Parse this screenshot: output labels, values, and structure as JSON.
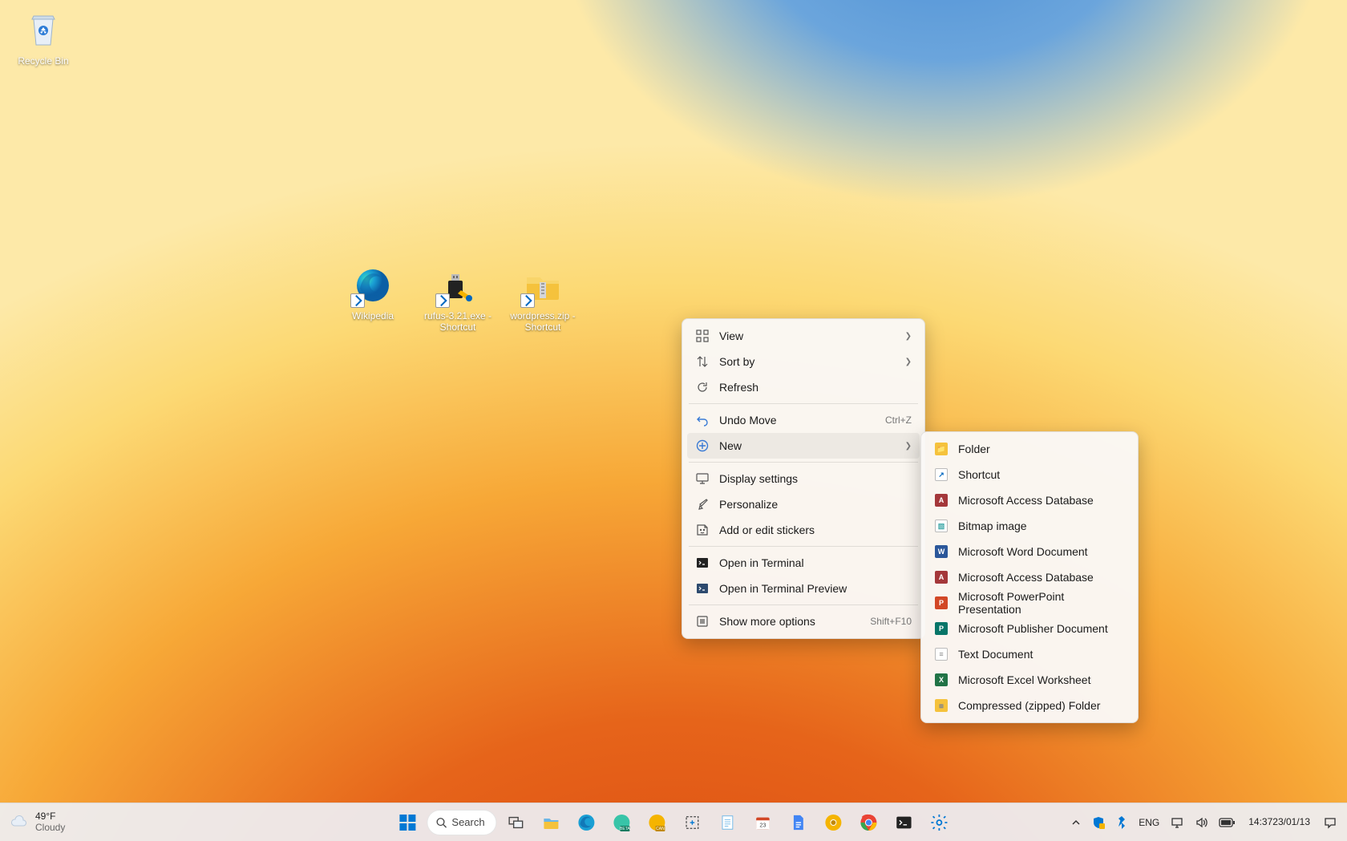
{
  "desktop_icons": {
    "recycle_bin": "Recycle Bin",
    "wikipedia": "Wikipedia",
    "rufus": "rufus-3.21.exe - Shortcut",
    "wordpress": "wordpress.zip - Shortcut"
  },
  "context_menu": {
    "view": "View",
    "sort_by": "Sort by",
    "refresh": "Refresh",
    "undo_move": "Undo Move",
    "undo_move_accel": "Ctrl+Z",
    "new": "New",
    "display_settings": "Display settings",
    "personalize": "Personalize",
    "add_stickers": "Add or edit stickers",
    "open_terminal": "Open in Terminal",
    "open_terminal_preview": "Open in Terminal Preview",
    "show_more": "Show more options",
    "show_more_accel": "Shift+F10"
  },
  "new_submenu": {
    "folder": "Folder",
    "shortcut": "Shortcut",
    "access": "Microsoft Access Database",
    "bitmap": "Bitmap image",
    "word": "Microsoft Word Document",
    "access2": "Microsoft Access Database",
    "ppt": "Microsoft PowerPoint Presentation",
    "publisher": "Microsoft Publisher Document",
    "text": "Text Document",
    "excel": "Microsoft Excel Worksheet",
    "zip": "Compressed (zipped) Folder"
  },
  "taskbar": {
    "search": "Search",
    "weather_temp": "49°F",
    "weather_desc": "Cloudy",
    "lang": "ENG",
    "time": "14:37",
    "date": "23/01/13"
  },
  "colors": {
    "accent": "#0067c0",
    "folder": "#f5c23c",
    "access": "#a4373a",
    "word": "#2b579a",
    "ppt": "#d24726",
    "excel": "#217346",
    "publisher": "#077568",
    "bluetooth": "#0078d4"
  }
}
